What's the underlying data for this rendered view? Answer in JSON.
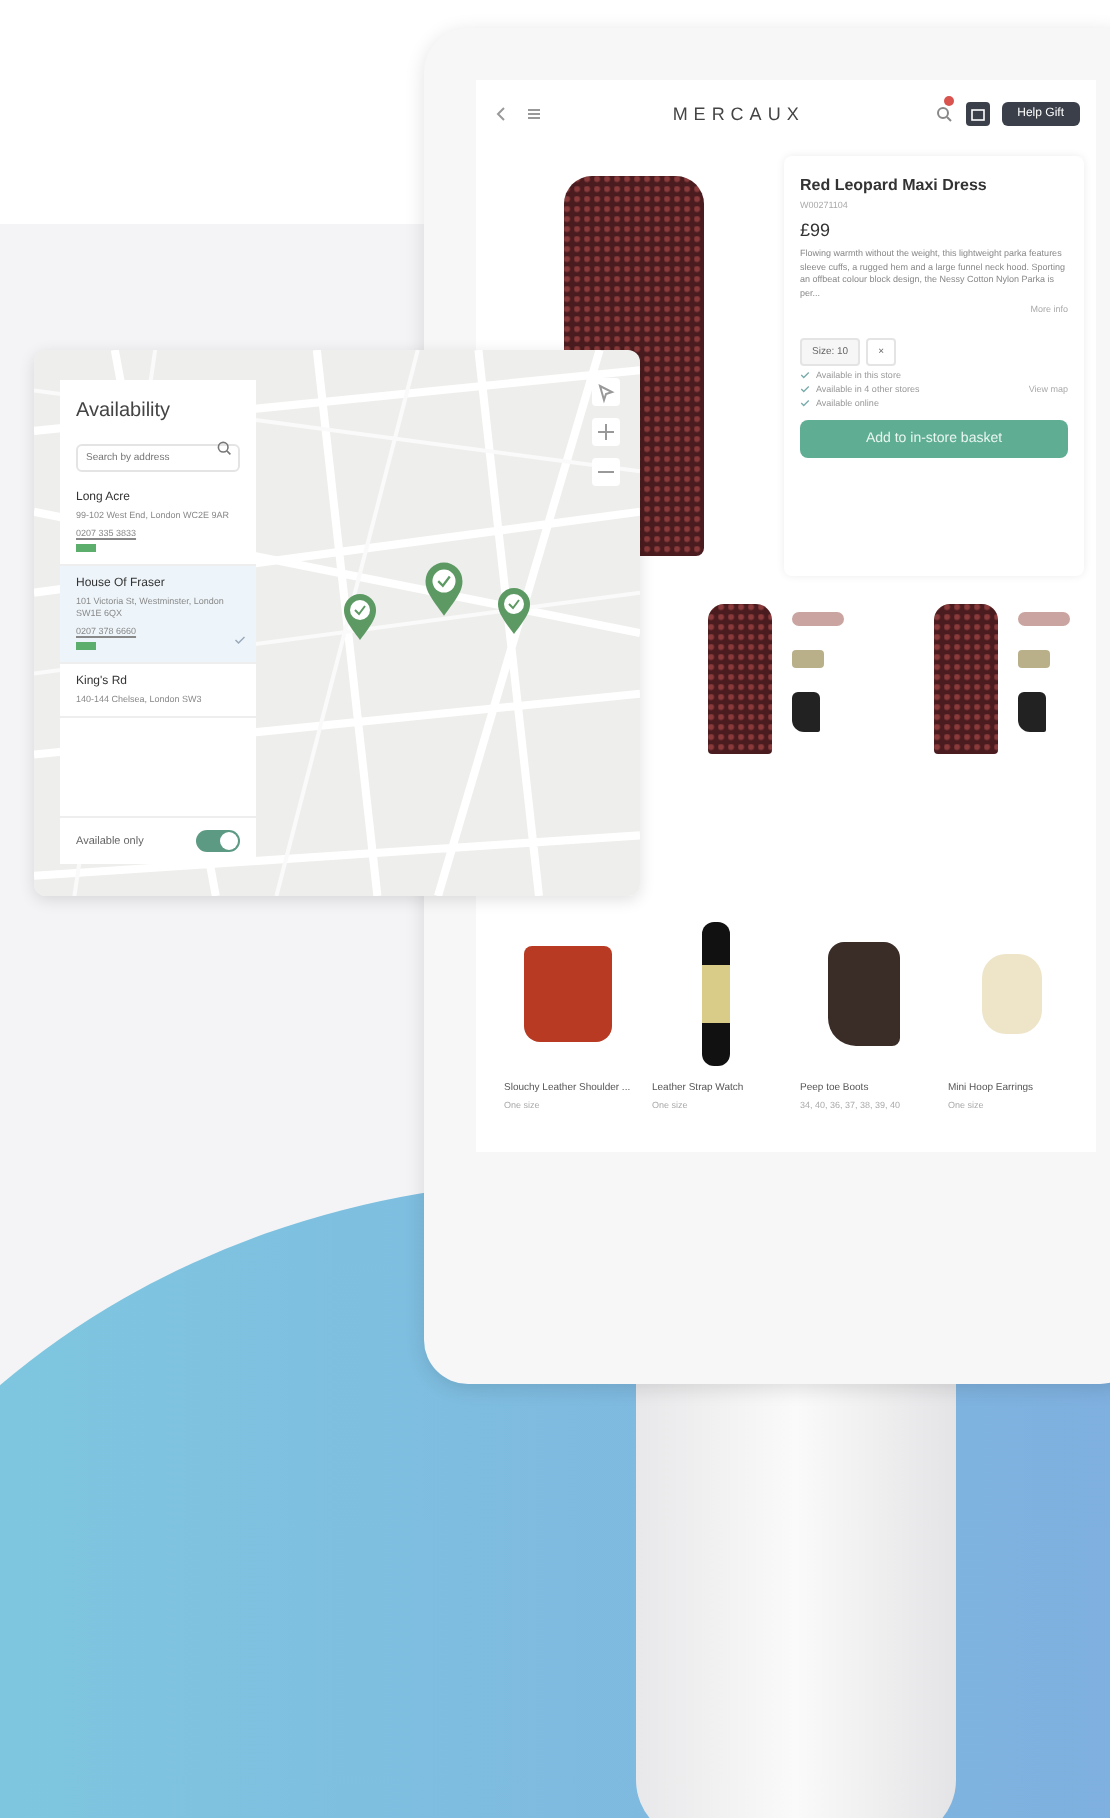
{
  "kiosk": {
    "header": {
      "logo": "MERCAUX",
      "help_button": "Help Gift"
    },
    "product": {
      "title": "Red Leopard Maxi Dress",
      "sku": "W00271104",
      "price": "£99",
      "description": "Flowing warmth without the weight, this lightweight parka features sleeve cuffs, a rugged hem and a large funnel neck hood. Sporting an offbeat colour block design, the Nessy Cotton Nylon Parka is per...",
      "more_link": "More info",
      "size_chip": "Size: 10",
      "size_clear": "×",
      "availability": [
        {
          "text": "Available in this store"
        },
        {
          "text": "Available in 4 other stores",
          "link": "View map"
        },
        {
          "text": "Available online"
        }
      ],
      "add_button": "Add to in-store basket"
    },
    "products": [
      {
        "name": "Slouchy Leather Shoulder ...",
        "sizes": "One size",
        "kind": "bag"
      },
      {
        "name": "Leather Strap Watch",
        "sizes": "One size",
        "kind": "watch"
      },
      {
        "name": "Peep toe Boots",
        "sizes": "34, 40, 36, 37, 38, 39, 40",
        "kind": "boot"
      },
      {
        "name": "Mini Hoop Earrings",
        "sizes": "One size",
        "kind": "earrings"
      }
    ]
  },
  "availability_panel": {
    "title": "Availability",
    "search": {
      "placeholder": "Search by address"
    },
    "stores": [
      {
        "name": "Long Acre",
        "address": "99-102 West End, London WC2E 9AR",
        "phone": "0207 335 3833",
        "stock_badge": true,
        "selected": false
      },
      {
        "name": "House Of Fraser",
        "address": "101 Victoria St, Westminster, London SW1E 6QX",
        "phone": "0207 378 6660",
        "stock_badge": true,
        "selected": true
      },
      {
        "name": "King's Rd",
        "address": "140-144 Chelsea, London SW3",
        "stock_badge": false,
        "selected": false
      }
    ],
    "filter": {
      "label": "Available only",
      "on": true
    }
  }
}
